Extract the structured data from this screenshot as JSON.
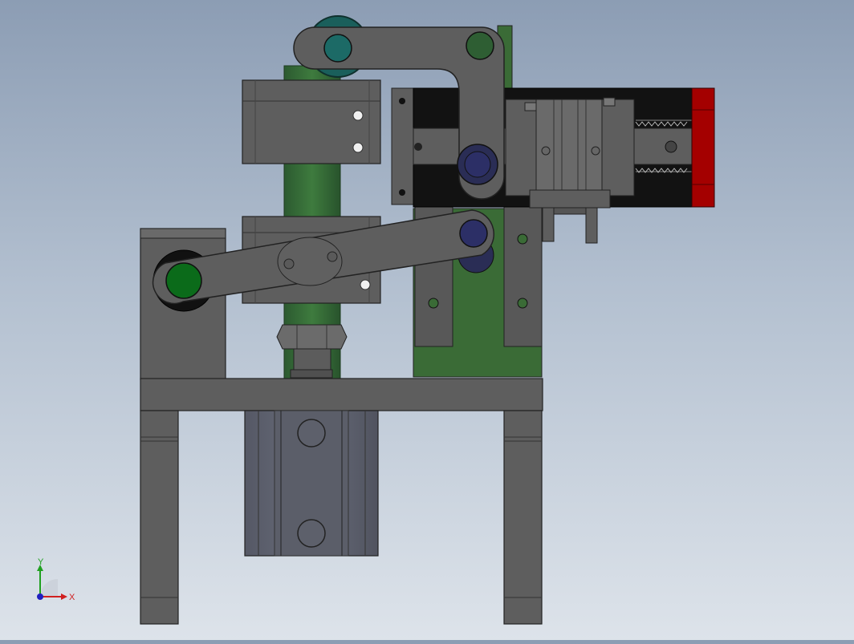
{
  "viewport": {
    "background_top": "#8c9db4",
    "background_bottom": "#dde3ea"
  },
  "colors": {
    "steel": "#5b5b5b",
    "steel_light": "#6a6a6a",
    "steel_dark": "#333333",
    "green": "#2e5e33",
    "green_light": "#3f7a3c",
    "red": "#a00000",
    "black": "#111111",
    "cylinder": "#5c5f6a",
    "blue_pin": "#2c2f66",
    "teal_roller": "#1c6a66",
    "green_roller": "#0b6b1a"
  },
  "triad": {
    "x_label": "X",
    "y_label": "Y",
    "x_color": "#d02020",
    "y_color": "#20a020",
    "z_color": "#2020c0"
  },
  "model": {
    "view": "front",
    "parts": [
      "base-frame",
      "left-leg",
      "right-leg",
      "air-cylinder",
      "green-column",
      "hex-nut",
      "upper-clamp-block",
      "lower-clamp-block",
      "left-pivot-block",
      "lower-lever-arm",
      "upper-link-arm",
      "linear-slide",
      "gripper-unit",
      "red-end-cap"
    ]
  }
}
